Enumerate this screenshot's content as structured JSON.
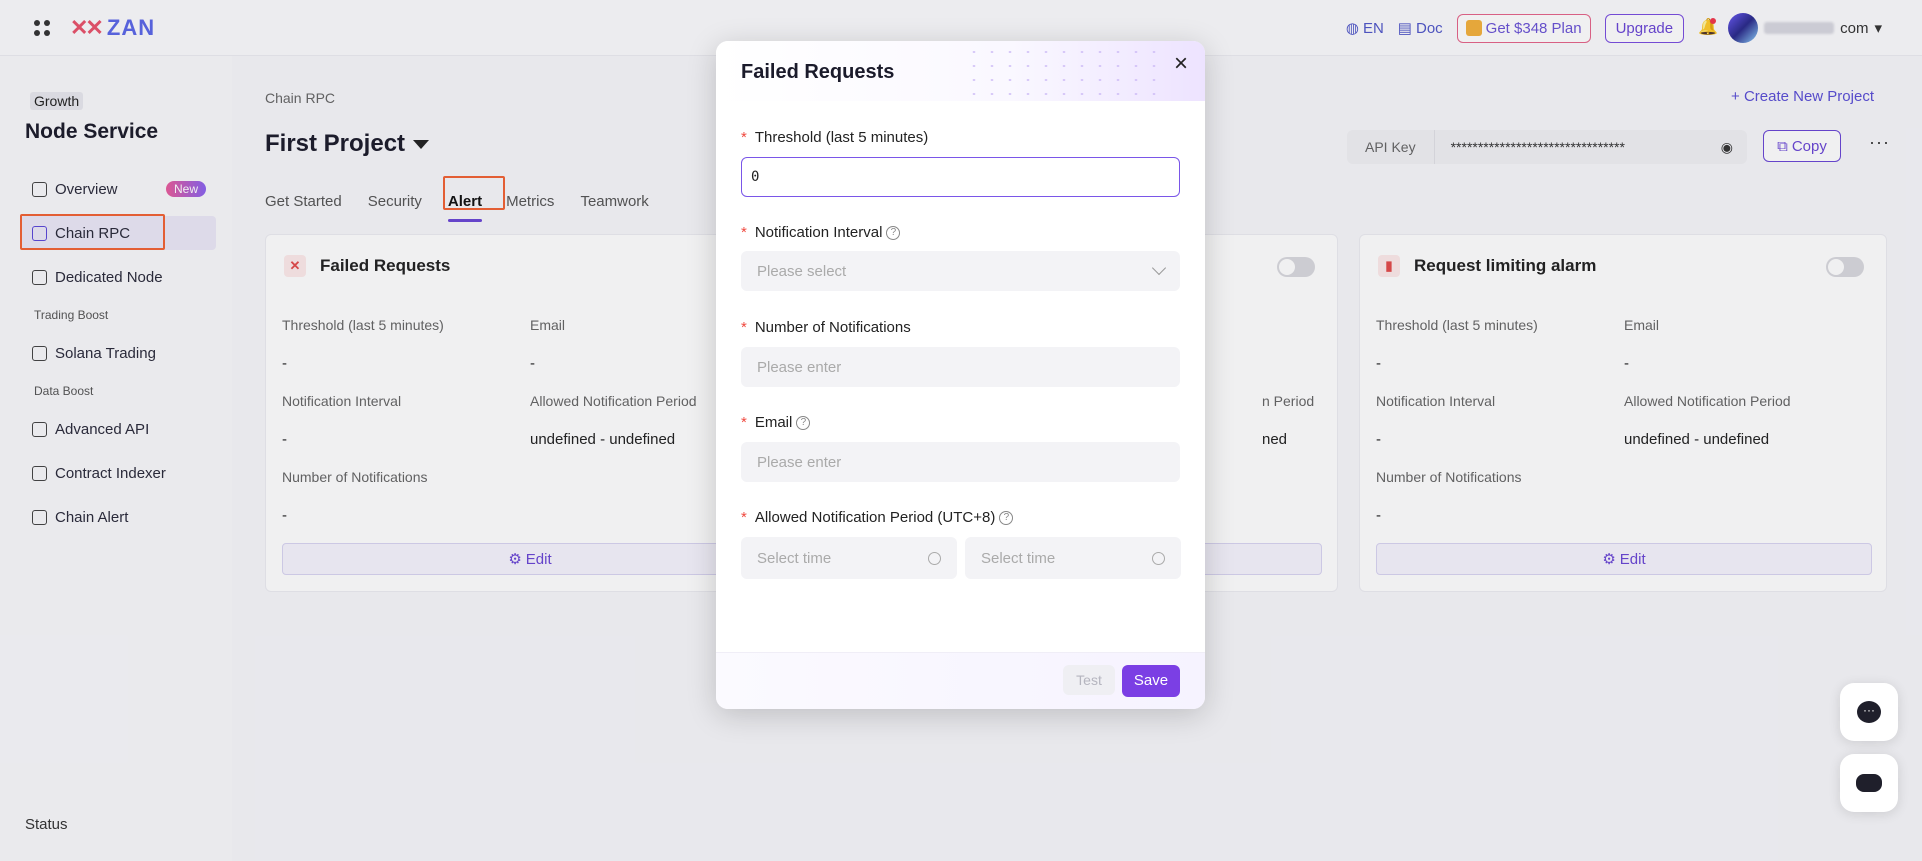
{
  "topbar": {
    "logo": "ZAN",
    "language": "EN",
    "doc": "Doc",
    "gift_plan": "Get $348 Plan",
    "upgrade": "Upgrade",
    "user_suffix": "com"
  },
  "sidebar": {
    "tier": "Growth",
    "title": "Node Service",
    "items": [
      {
        "label": "Overview",
        "badge": "New"
      },
      {
        "label": "Chain RPC"
      },
      {
        "label": "Dedicated Node"
      },
      {
        "label": "Solana Trading"
      },
      {
        "label": "Advanced API"
      },
      {
        "label": "Contract Indexer"
      },
      {
        "label": "Chain Alert"
      }
    ],
    "groups": [
      "Trading Boost",
      "Data Boost"
    ],
    "status": "Status"
  },
  "main": {
    "breadcrumb": "Chain RPC",
    "create_project": "+ Create New Project",
    "project_name": "First Project",
    "api_key_label": "API Key",
    "api_key_value": "********************************",
    "copy": "Copy",
    "tabs": [
      "Get Started",
      "Security",
      "Alert",
      "Metrics",
      "Teamwork"
    ],
    "active_tab": "Alert"
  },
  "cards": [
    {
      "title": "Failed Requests",
      "threshold_label": "Threshold (last 5 minutes)",
      "threshold_value": "-",
      "email_label": "Email",
      "email_value": "-",
      "interval_label": "Notification Interval",
      "interval_value": "-",
      "period_label": "Allowed Notification Period",
      "period_value": "undefined - undefined",
      "count_label": "Number of Notifications",
      "count_value": "-",
      "edit": "Edit"
    },
    {
      "title": "Request limiting alarm",
      "threshold_label": "Threshold (last 5 minutes)",
      "threshold_value": "-",
      "email_label": "Email",
      "email_value": "-",
      "interval_label": "Notification Interval",
      "interval_value": "-",
      "period_label": "Allowed Notification Period",
      "period_value": "undefined - undefined",
      "count_label": "Number of Notifications",
      "count_value": "-",
      "edit": "Edit"
    },
    {
      "period_label_partial": "n Period",
      "period_value_partial": "ned"
    }
  ],
  "modal": {
    "title": "Failed Requests",
    "threshold_label": "Threshold (last 5 minutes)",
    "threshold_value": "0",
    "interval_label": "Notification Interval",
    "interval_placeholder": "Please select",
    "count_label": "Number of Notifications",
    "count_placeholder": "Please enter",
    "email_label": "Email",
    "email_placeholder": "Please enter",
    "period_label": "Allowed Notification Period (UTC+8)",
    "time_placeholder": "Select time",
    "test": "Test",
    "save": "Save"
  }
}
